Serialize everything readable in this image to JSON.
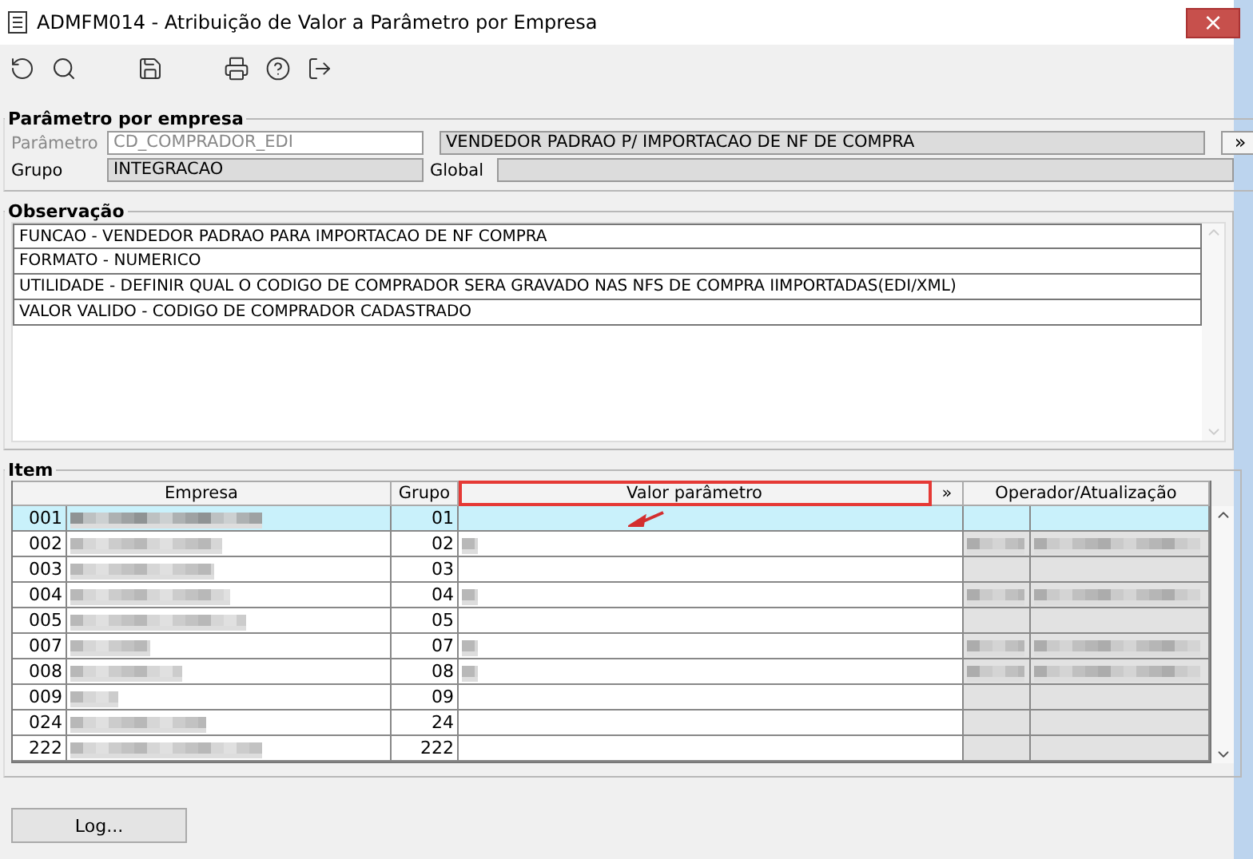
{
  "window": {
    "title": "ADMFM014 - Atribuição de Valor a Parâmetro por Empresa",
    "close": "×"
  },
  "parametro_group": {
    "title": "Parâmetro por empresa",
    "parametro_label": "Parâmetro",
    "parametro_value": "CD_COMPRADOR_EDI",
    "description": "VENDEDOR PADRAO P/ IMPORTACAO DE NF DE COMPRA",
    "more_button": "»",
    "grupo_label": "Grupo",
    "grupo_value": "INTEGRACAO",
    "global_label": "Global"
  },
  "observacao_group": {
    "title": "Observação",
    "lines": [
      "FUNCAO - VENDEDOR PADRAO PARA IMPORTACAO DE NF COMPRA",
      "FORMATO - NUMERICO",
      "UTILIDADE - DEFINIR QUAL O CODIGO DE COMPRADOR SERA GRAVADO NAS NFS DE COMPRA IIMPORTADAS(EDI/XML)",
      "VALOR VALIDO - CODIGO DE COMPRADOR CADASTRADO"
    ]
  },
  "item_group": {
    "title": "Item",
    "columns": [
      "Empresa",
      "Grupo",
      "Valor parâmetro",
      "»",
      "Operador/Atualização"
    ],
    "rows": [
      {
        "code": "001",
        "grupo": "01",
        "selected": true,
        "value_blurred": false,
        "operator_blurred": false
      },
      {
        "code": "002",
        "grupo": "02",
        "selected": false,
        "value_blurred": true,
        "operator_blurred": true
      },
      {
        "code": "003",
        "grupo": "03",
        "selected": false,
        "value_blurred": false,
        "operator_blurred": false
      },
      {
        "code": "004",
        "grupo": "04",
        "selected": false,
        "value_blurred": true,
        "operator_blurred": true
      },
      {
        "code": "005",
        "grupo": "05",
        "selected": false,
        "value_blurred": false,
        "operator_blurred": false
      },
      {
        "code": "007",
        "grupo": "07",
        "selected": false,
        "value_blurred": true,
        "operator_blurred": true
      },
      {
        "code": "008",
        "grupo": "08",
        "selected": false,
        "value_blurred": true,
        "operator_blurred": true
      },
      {
        "code": "009",
        "grupo": "09",
        "selected": false,
        "value_blurred": false,
        "operator_blurred": false
      },
      {
        "code": "024",
        "grupo": "24",
        "selected": false,
        "value_blurred": false,
        "operator_blurred": false
      },
      {
        "code": "222",
        "grupo": "222",
        "selected": false,
        "value_blurred": false,
        "operator_blurred": false
      }
    ]
  },
  "log_button": "Log..."
}
